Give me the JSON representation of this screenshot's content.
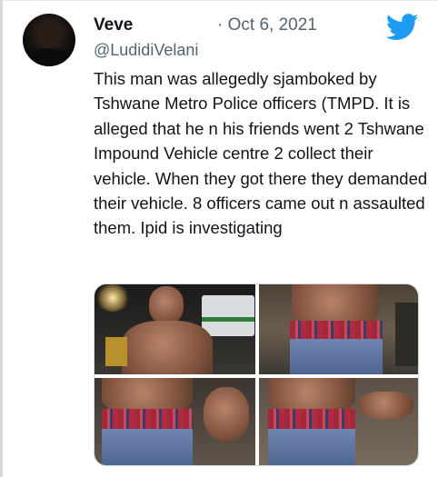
{
  "tweet": {
    "author_name": "Veve",
    "date": "· Oct 6, 2021",
    "handle": "@LudidiVelani",
    "text": "This man was allegedly sjamboked by Tshwane Metro Police officers (TMPD. It is alleged that he n his friends went 2 Tshwane Impound Vehicle centre 2 collect their vehicle. When they got there they demanded their vehicle. 8 officers came out n assaulted them. Ipid is investigating"
  },
  "icons": {
    "logo": "twitter-bird-icon",
    "logo_color": "#1d9bf0"
  },
  "media": {
    "photo_count": 4
  },
  "colors": {
    "text": "#0f1419",
    "secondary": "#536471",
    "accent": "#1d9bf0"
  }
}
